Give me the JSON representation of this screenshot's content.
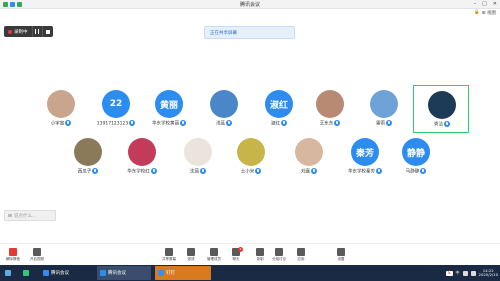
{
  "app": {
    "title": "腾讯会议"
  },
  "subbar": {
    "lock_text": "🔒",
    "view_label": "⊞ 视图"
  },
  "recording": {
    "label": "录制中",
    "pause_icon": "pause-icon",
    "stop_icon": "stop-icon"
  },
  "share_banner": {
    "text": "正在共享屏幕"
  },
  "participants": [
    {
      "name": "小宇宙",
      "kind": "photo",
      "initials": "",
      "color": "#c9a58d"
    },
    {
      "name": "13917123123",
      "kind": "blue",
      "initials": "22",
      "color": "#2d8cf0"
    },
    {
      "name": "华东学校黄丽",
      "kind": "blue",
      "initials": "黄丽",
      "color": "#2d8cf0"
    },
    {
      "name": "浅蓝",
      "kind": "photo",
      "initials": "",
      "color": "#4a86c8"
    },
    {
      "name": "淑红",
      "kind": "blue",
      "initials": "淑红",
      "color": "#2d8cf0"
    },
    {
      "name": "王东东",
      "kind": "photo",
      "initials": "",
      "color": "#b88a74"
    },
    {
      "name": "雷雨",
      "kind": "photo",
      "initials": "",
      "color": "#6fa3d8"
    },
    {
      "name": "秀洁",
      "kind": "photo",
      "initials": "",
      "color": "#1d3b57"
    },
    {
      "name": "西瓜子",
      "kind": "photo",
      "initials": "",
      "color": "#8a7a5a"
    },
    {
      "name": "华东学校红",
      "kind": "photo",
      "initials": "",
      "color": "#c23b5a"
    },
    {
      "name": "沈丽",
      "kind": "photo",
      "initials": "",
      "color": "#eae4dc"
    },
    {
      "name": "土小米",
      "kind": "photo",
      "initials": "",
      "color": "#c7b54a"
    },
    {
      "name": "刘嘉",
      "kind": "photo",
      "initials": "",
      "color": "#d8b7a1"
    },
    {
      "name": "华东学校秦芳",
      "kind": "blue",
      "initials": "秦芳",
      "color": "#2d8cf0"
    },
    {
      "name": "马静静",
      "kind": "blue",
      "initials": "静静",
      "color": "#2d8cf0"
    }
  ],
  "chat": {
    "placeholder": "说点什么..."
  },
  "toolbar": {
    "items": [
      {
        "label": "解除静音",
        "icon": "mic-icon"
      },
      {
        "label": "开启视频",
        "icon": "camera-icon"
      },
      {
        "label": "共享屏幕",
        "icon": "share-icon"
      },
      {
        "label": "邀请",
        "icon": "invite-icon"
      },
      {
        "label": "管理成员",
        "icon": "members-icon"
      },
      {
        "label": "聊天",
        "icon": "chat-icon",
        "badge": "1"
      },
      {
        "label": "录制",
        "icon": "record-icon"
      },
      {
        "label": "分组讨论",
        "icon": "group-icon"
      },
      {
        "label": "应用",
        "icon": "apps-icon"
      },
      {
        "label": "设置",
        "icon": "settings-icon"
      }
    ],
    "left_labels": [
      "解除静音",
      "开启视频"
    ]
  },
  "taskbar": {
    "items": [
      {
        "label": "腾讯会议",
        "color": "#2d8cf0"
      },
      {
        "label": "腾讯会议",
        "color": "#2d8cf0"
      },
      {
        "label": "钉钉",
        "color": "#3a8ef0"
      }
    ],
    "input_method": "S",
    "lang": "中",
    "time": "14:22",
    "date": "2020/2/10"
  }
}
